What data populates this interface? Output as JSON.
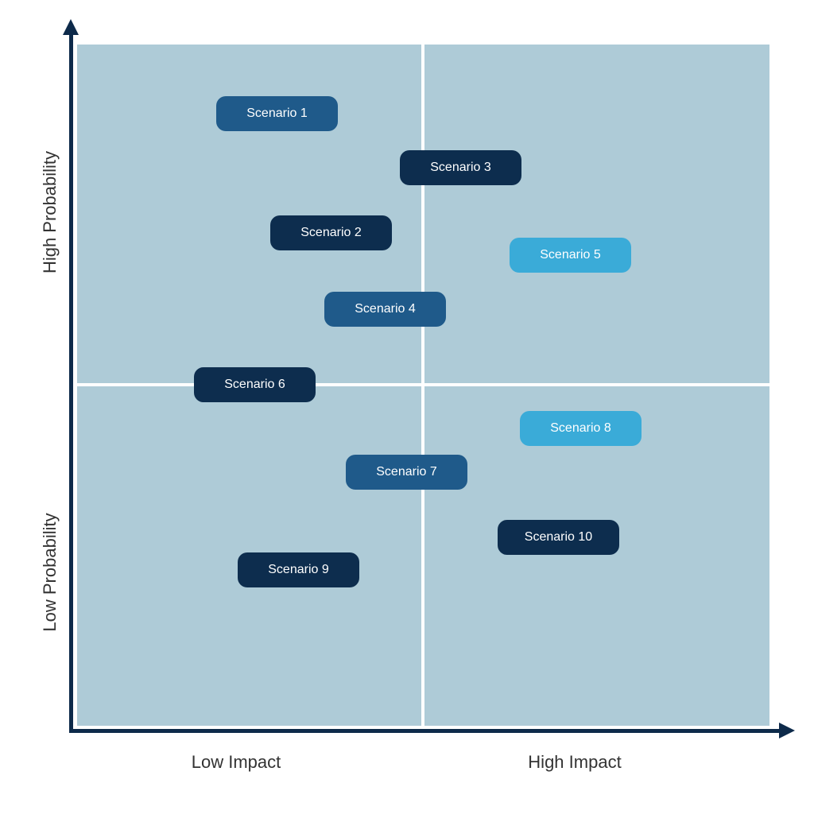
{
  "axes": {
    "y_high_label": "High Probability",
    "y_low_label": "Low Probability",
    "x_low_label": "Low Impact",
    "x_high_label": "High Impact"
  },
  "colors": {
    "background_quadrant": "#aecbd7",
    "axis": "#0d2a4a",
    "chip_medium": "#1f5a8a",
    "chip_dark": "#0d2d4e",
    "chip_light": "#3aabd8"
  },
  "scenarios": [
    {
      "label": "Scenario 1",
      "style": "medium"
    },
    {
      "label": "Scenario 2",
      "style": "dark"
    },
    {
      "label": "Scenario 3",
      "style": "dark"
    },
    {
      "label": "Scenario 4",
      "style": "medium"
    },
    {
      "label": "Scenario 5",
      "style": "light"
    },
    {
      "label": "Scenario 6",
      "style": "dark"
    },
    {
      "label": "Scenario 7",
      "style": "medium"
    },
    {
      "label": "Scenario 8",
      "style": "light"
    },
    {
      "label": "Scenario 9",
      "style": "dark"
    },
    {
      "label": "Scenario 10",
      "style": "dark"
    }
  ]
}
